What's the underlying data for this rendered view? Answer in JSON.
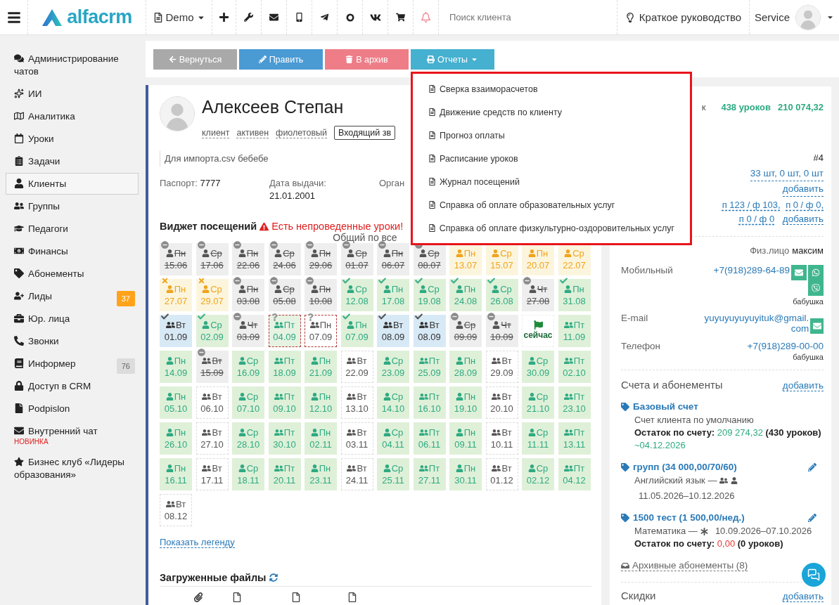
{
  "topbar": {
    "logo": "alfacrm",
    "branch": "Demo",
    "search": {
      "placeholder": "Поиск клиента"
    },
    "guide": "Краткое руководство",
    "user": "Service"
  },
  "sidebar": {
    "items": [
      {
        "label": "Администрирование чатов",
        "selected": false
      },
      {
        "label": "ИИ",
        "selected": false
      },
      {
        "label": "Аналитика",
        "selected": false
      },
      {
        "label": "Уроки",
        "selected": false
      },
      {
        "label": "Задачи",
        "selected": false
      },
      {
        "label": "Клиенты",
        "selected": true
      },
      {
        "label": "Группы",
        "selected": false
      },
      {
        "label": "Педагоги",
        "selected": false
      },
      {
        "label": "Финансы",
        "selected": false
      },
      {
        "label": "Абонементы",
        "selected": false
      },
      {
        "label": "Лиды",
        "selected": false,
        "badge": {
          "text": "37",
          "kind": "warning"
        }
      },
      {
        "label": "Юр. лица",
        "selected": false
      },
      {
        "label": "Звонки",
        "selected": false
      },
      {
        "label": "Информер",
        "selected": false,
        "badge": {
          "text": "76",
          "kind": "muted"
        }
      },
      {
        "label": "Доступ в CRM",
        "selected": false
      },
      {
        "label": "Podpislon",
        "selected": false
      },
      {
        "label": "Внутренний чат",
        "selected": false,
        "note": "НОВИНКА"
      },
      {
        "label": "Бизнес клуб «Лидеры образования»",
        "selected": false
      }
    ]
  },
  "toolbar": {
    "buttons": [
      {
        "label": "Вернуться",
        "kind": "back"
      },
      {
        "label": "Править",
        "kind": "edit"
      },
      {
        "label": "В архив",
        "kind": "archive"
      },
      {
        "label": "Отчеты",
        "kind": "reports",
        "menu": {
          "expanded": true,
          "items": [
            "Сверка взаиморасчетов",
            "Движение средств по клиенту",
            "Прогноз оплаты",
            "Расписание уроков",
            "Журнал посещений",
            "Справка об оплате образовательных услуг",
            "Справка об оплате физкультурно-оздоровительных услуг"
          ]
        }
      }
    ]
  },
  "client": {
    "name": "Алексеев Степан",
    "tags": [
      "клиент",
      "активен",
      "фиолетовый"
    ],
    "source": "Входящий зв",
    "note": "Для импорта.csv бебебе",
    "fields": [
      {
        "label": "Паспорт:",
        "value": "7777"
      },
      {
        "label": "Дата выдачи:",
        "value": "21.01.2001"
      },
      {
        "label": "Орган"
      }
    ]
  },
  "attendance": {
    "title": "Виджет посещений",
    "warning": "Есть непроведенные уроки!",
    "subtitle": "Общий по все",
    "legend_link": "Показать легенду",
    "cells": [
      {
        "kind": "cancelled",
        "day": "Пн",
        "date": "15.06",
        "group": false
      },
      {
        "kind": "cancelled",
        "day": "Ср",
        "date": "17.06",
        "group": false
      },
      {
        "kind": "cancelled",
        "day": "Пн",
        "date": "22.06",
        "group": false
      },
      {
        "kind": "cancelled",
        "day": "Ср",
        "date": "24.06",
        "group": false
      },
      {
        "kind": "cancelled",
        "day": "Пн",
        "date": "29.06",
        "group": false
      },
      {
        "kind": "cancelled",
        "day": "Ср",
        "date": "01.07",
        "group": false
      },
      {
        "kind": "cancelled",
        "day": "Пн",
        "date": "06.07",
        "group": false
      },
      {
        "kind": "cancelled",
        "day": "Ср",
        "date": "08.07",
        "group": false
      },
      {
        "kind": "unpaid",
        "day": "Пн",
        "date": "13.07",
        "group": false
      },
      {
        "kind": "unpaid",
        "day": "Ср",
        "date": "15.07",
        "group": false
      },
      {
        "kind": "unpaid",
        "day": "Пн",
        "date": "20.07",
        "group": false
      },
      {
        "kind": "unpaid",
        "day": "Ср",
        "date": "22.07",
        "group": false
      },
      {
        "kind": "missed",
        "day": "Пн",
        "date": "27.07",
        "group": false
      },
      {
        "kind": "missed",
        "day": "Ср",
        "date": "29.07",
        "group": false
      },
      {
        "kind": "cancelled",
        "day": "Пн",
        "date": "03.08",
        "group": false
      },
      {
        "kind": "cancelled",
        "day": "Ср",
        "date": "05.08",
        "group": false
      },
      {
        "kind": "cancelled",
        "day": "Пн",
        "date": "10.08",
        "group": false
      },
      {
        "kind": "attended",
        "day": "Ср",
        "date": "12.08",
        "group": false
      },
      {
        "kind": "attended",
        "day": "Пн",
        "date": "17.08",
        "group": false
      },
      {
        "kind": "attended",
        "day": "Ср",
        "date": "19.08",
        "group": false
      },
      {
        "kind": "attended",
        "day": "Пн",
        "date": "24.08",
        "group": false
      },
      {
        "kind": "attended",
        "day": "Ср",
        "date": "26.08",
        "group": false
      },
      {
        "kind": "cancelled",
        "day": "Чт",
        "date": "27.08",
        "group": false
      },
      {
        "kind": "attended",
        "day": "Пн",
        "date": "31.08",
        "group": false
      },
      {
        "kind": "charged",
        "day": "Вт",
        "date": "01.09",
        "group": true
      },
      {
        "kind": "attended",
        "day": "Ср",
        "date": "02.09",
        "group": false
      },
      {
        "kind": "cancelled",
        "day": "Чт",
        "date": "03.09",
        "group": false
      },
      {
        "kind": "pending",
        "day": "Пт",
        "date": "04.09",
        "group": true
      },
      {
        "kind": "unmarked",
        "day": "Пн",
        "date": "07.09",
        "group": true
      },
      {
        "kind": "attended",
        "day": "Пн",
        "date": "07.09",
        "group": false
      },
      {
        "kind": "charged",
        "day": "Вт",
        "date": "08.09",
        "group": true
      },
      {
        "kind": "charged",
        "day": "Вт",
        "date": "08.09",
        "group": true
      },
      {
        "kind": "cancelled",
        "day": "Ср",
        "date": "09.09",
        "group": false
      },
      {
        "kind": "cancelled",
        "day": "Чт",
        "date": "10.09",
        "group": false
      },
      {
        "kind": "now",
        "label": "сейчас"
      },
      {
        "kind": "planned",
        "day": "Пт",
        "date": "11.09",
        "group": true
      },
      {
        "kind": "planned",
        "day": "Пн",
        "date": "14.09",
        "group": false
      },
      {
        "kind": "cancelled",
        "day": "Вт",
        "date": "15.09",
        "group": true
      },
      {
        "kind": "planned",
        "day": "Ср",
        "date": "16.09",
        "group": false
      },
      {
        "kind": "planned",
        "day": "Пт",
        "date": "18.09",
        "group": true
      },
      {
        "kind": "planned",
        "day": "Пн",
        "date": "21.09",
        "group": false
      },
      {
        "kind": "free",
        "day": "Вт",
        "date": "22.09",
        "group": true
      },
      {
        "kind": "planned",
        "day": "Ср",
        "date": "23.09",
        "group": false
      },
      {
        "kind": "planned",
        "day": "Пт",
        "date": "25.09",
        "group": true
      },
      {
        "kind": "planned",
        "day": "Пн",
        "date": "28.09",
        "group": false
      },
      {
        "kind": "free",
        "day": "Вт",
        "date": "29.09",
        "group": true
      },
      {
        "kind": "planned",
        "day": "Ср",
        "date": "30.09",
        "group": false
      },
      {
        "kind": "planned",
        "day": "Пт",
        "date": "02.10",
        "group": true
      },
      {
        "kind": "planned",
        "day": "Пн",
        "date": "05.10",
        "group": false
      },
      {
        "kind": "free",
        "day": "Вт",
        "date": "06.10",
        "group": true
      },
      {
        "kind": "planned",
        "day": "Ср",
        "date": "07.10",
        "group": false
      },
      {
        "kind": "planned",
        "day": "Пт",
        "date": "09.10",
        "group": true
      },
      {
        "kind": "planned",
        "day": "Пн",
        "date": "12.10",
        "group": false
      },
      {
        "kind": "free",
        "day": "Вт",
        "date": "13.10",
        "group": true
      },
      {
        "kind": "planned",
        "day": "Ср",
        "date": "14.10",
        "group": false
      },
      {
        "kind": "planned",
        "day": "Пт",
        "date": "16.10",
        "group": true
      },
      {
        "kind": "planned",
        "day": "Пн",
        "date": "19.10",
        "group": false
      },
      {
        "kind": "free",
        "day": "Вт",
        "date": "20.10",
        "group": true
      },
      {
        "kind": "planned",
        "day": "Ср",
        "date": "21.10",
        "group": false
      },
      {
        "kind": "planned",
        "day": "Пт",
        "date": "23.10",
        "group": true
      },
      {
        "kind": "planned",
        "day": "Пн",
        "date": "26.10",
        "group": false
      },
      {
        "kind": "free",
        "day": "Вт",
        "date": "27.10",
        "group": true
      },
      {
        "kind": "planned",
        "day": "Ср",
        "date": "28.10",
        "group": false
      },
      {
        "kind": "planned",
        "day": "Пт",
        "date": "30.10",
        "group": true
      },
      {
        "kind": "planned",
        "day": "Пн",
        "date": "02.11",
        "group": false
      },
      {
        "kind": "free",
        "day": "Вт",
        "date": "03.11",
        "group": true
      },
      {
        "kind": "planned",
        "day": "Ср",
        "date": "04.11",
        "group": false
      },
      {
        "kind": "planned",
        "day": "Пт",
        "date": "06.11",
        "group": true
      },
      {
        "kind": "planned",
        "day": "Пн",
        "date": "09.11",
        "group": false
      },
      {
        "kind": "free",
        "day": "Вт",
        "date": "10.11",
        "group": true
      },
      {
        "kind": "planned",
        "day": "Ср",
        "date": "11.11",
        "group": false
      },
      {
        "kind": "planned",
        "day": "Пт",
        "date": "13.11",
        "group": true
      },
      {
        "kind": "planned",
        "day": "Пн",
        "date": "16.11",
        "group": false
      },
      {
        "kind": "free",
        "day": "Вт",
        "date": "17.11",
        "group": true
      },
      {
        "kind": "planned",
        "day": "Ср",
        "date": "18.11",
        "group": false
      },
      {
        "kind": "planned",
        "day": "Пт",
        "date": "20.11",
        "group": true
      },
      {
        "kind": "planned",
        "day": "Пн",
        "date": "23.11",
        "group": false
      },
      {
        "kind": "free",
        "day": "Вт",
        "date": "24.11",
        "group": true
      },
      {
        "kind": "planned",
        "day": "Ср",
        "date": "25.11",
        "group": false
      },
      {
        "kind": "planned",
        "day": "Пт",
        "date": "27.11",
        "group": true
      },
      {
        "kind": "planned",
        "day": "Пн",
        "date": "30.11",
        "group": false
      },
      {
        "kind": "free",
        "day": "Вт",
        "date": "01.12",
        "group": true
      },
      {
        "kind": "planned",
        "day": "Ср",
        "date": "02.12",
        "group": false
      },
      {
        "kind": "planned",
        "day": "Пт",
        "date": "04.12",
        "group": true
      },
      {
        "kind": "free",
        "day": "Вт",
        "date": "08.12",
        "group": true
      }
    ]
  },
  "files": {
    "title": "Загруженные файлы"
  },
  "summary": {
    "label": "к",
    "lessons": "438 уроков",
    "amount": "210 074,32",
    "number": "#4",
    "quantities": "33 шт, 0 шт, 0 шт",
    "quantities_add": "добавить",
    "plan": [
      "п 123 / ф 103,",
      "п 0 / ф 0,",
      "п 0 / ф 0"
    ],
    "plan_add": "добавить",
    "legal": {
      "label": "Физ.лицо",
      "value": "максим"
    }
  },
  "contacts": [
    {
      "kind": "mobile",
      "label": "Мобильный",
      "value": "+7(918)289-64-89",
      "note": "бабушка"
    },
    {
      "kind": "email",
      "label": "E-mail",
      "value": "yuyuyuyuyuyituk@gmail.com"
    },
    {
      "kind": "phone",
      "label": "Телефон",
      "value": "+7(918)289-00-00",
      "note": "бабушка"
    }
  ],
  "accounts": {
    "title": "Счета и абонементы",
    "add": "добавить",
    "items": [
      {
        "kind": "account",
        "name": "Базовый счет",
        "description": "Счет клиента по умолчанию",
        "balance": {
          "label": "Остаток по счету:",
          "amount": "209 274,32",
          "color": "#2eaa82",
          "lessons": "(430 уроков)",
          "until": "~04.12.2026"
        }
      },
      {
        "kind": "subscription",
        "name": "групп (34 000,00/70/60)",
        "subject": "Английский язык —",
        "period": "11.05.2026–10.12.2026"
      },
      {
        "kind": "subscription",
        "name": "1500 тест (1 500,00/нед.)",
        "subject": "Математика —",
        "period": "10.09.2026–07.10.2026",
        "balance": {
          "label": "Остаток по счету:",
          "amount": "0,00",
          "color": "#e53935",
          "lessons": "(0 уроков)"
        }
      }
    ],
    "archive": "Архивные абонементы (8)"
  },
  "discounts": {
    "title": "Скидки",
    "add": "добавить"
  }
}
